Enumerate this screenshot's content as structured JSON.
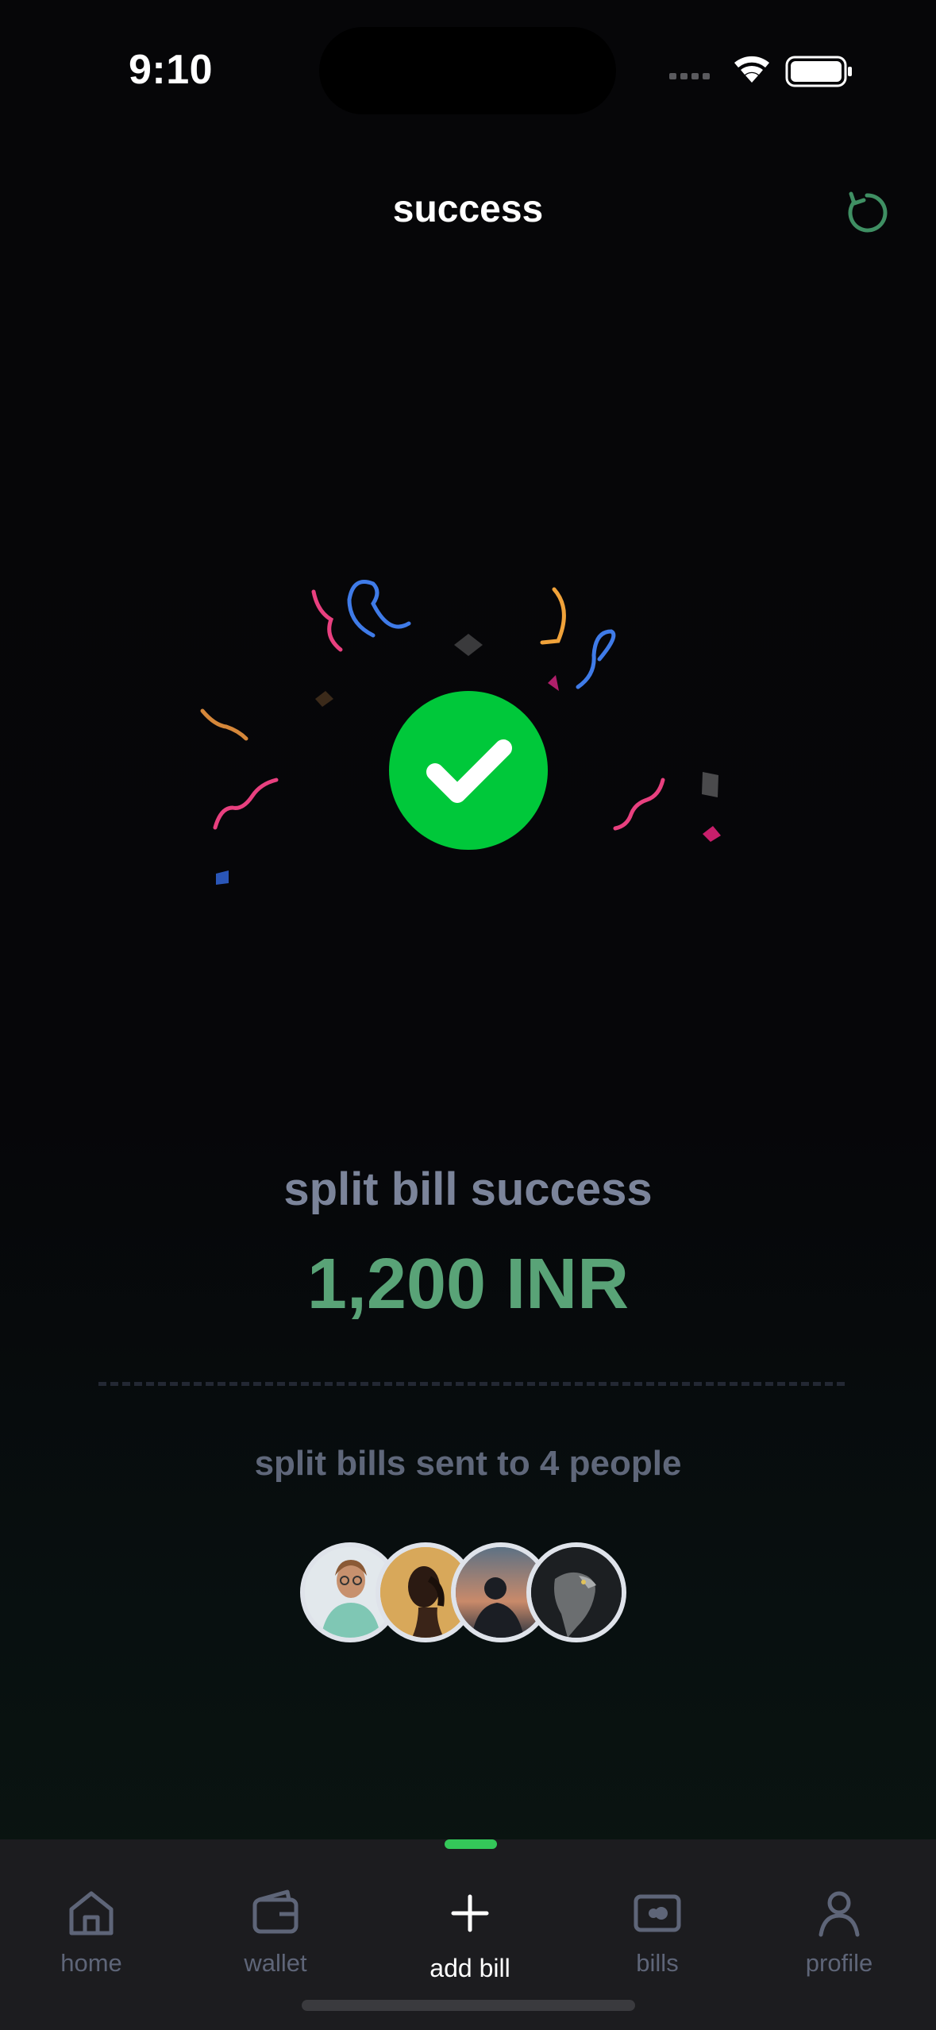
{
  "status_bar": {
    "time": "9:10"
  },
  "header": {
    "title": "success"
  },
  "success": {
    "subtitle": "split bill success",
    "amount": "1,200 INR",
    "sent_text": "split bills sent to 4 people",
    "avatars": [
      {
        "name": "avatar-person-1",
        "bg": "#dfe6ea"
      },
      {
        "name": "avatar-person-2",
        "bg": "#d4a458"
      },
      {
        "name": "avatar-person-3",
        "bg": "#4a5f73"
      },
      {
        "name": "avatar-person-4",
        "bg": "#1f2326"
      }
    ]
  },
  "tabs": [
    {
      "label": "home",
      "icon": "home-icon"
    },
    {
      "label": "wallet",
      "icon": "wallet-icon"
    },
    {
      "label": "add bill",
      "icon": "plus-icon",
      "active": true
    },
    {
      "label": "bills",
      "icon": "bills-icon"
    },
    {
      "label": "profile",
      "icon": "profile-icon"
    }
  ],
  "colors": {
    "accent_green": "#00c83a",
    "amount_green": "#59a377",
    "tab_active_indicator": "#34c759",
    "muted_text": "#7b849a"
  }
}
